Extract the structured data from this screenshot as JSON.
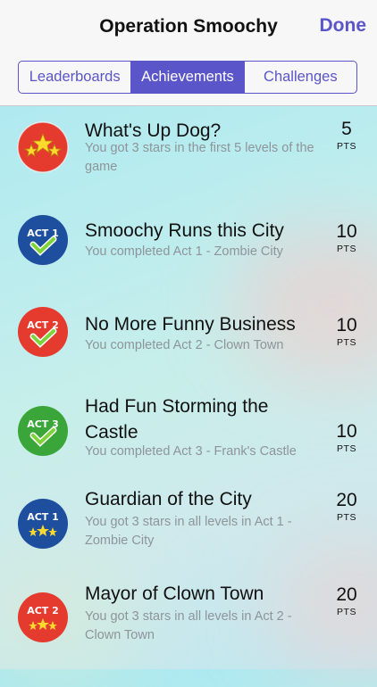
{
  "nav": {
    "title": "Operation Smoochy",
    "done_label": "Done"
  },
  "tabs": [
    {
      "label": "Leaderboards",
      "active": false
    },
    {
      "label": "Achievements",
      "active": true
    },
    {
      "label": "Challenges",
      "active": false
    }
  ],
  "pts_unit": "PTS",
  "achievements": [
    {
      "title": "What's Up Dog?",
      "description": "You got 3 stars in the first 5 levels of the game",
      "points": "5",
      "badge": {
        "icon": "three-stars-icon",
        "color": "#e53a2e"
      }
    },
    {
      "title": "Smoochy Runs this City",
      "description": "You completed Act 1 - Zombie City",
      "points": "10",
      "badge": {
        "icon": "act-1-check-icon",
        "label": "ACT 1",
        "color": "#1d4f9e"
      }
    },
    {
      "title": "No More Funny Business",
      "description": "You completed Act 2 - Clown Town",
      "points": "10",
      "badge": {
        "icon": "act-2-check-icon",
        "label": "ACT 2",
        "color": "#e53a2e"
      }
    },
    {
      "title": "Had Fun Storming the Castle",
      "description": "You completed Act 3 - Frank's Castle",
      "points": "10",
      "badge": {
        "icon": "act-3-check-icon",
        "label": "ACT 3",
        "color": "#3aa63a"
      }
    },
    {
      "title": "Guardian of the City",
      "description": "You got 3 stars in all levels in Act 1 - Zombie City",
      "points": "20",
      "badge": {
        "icon": "act-1-stars-icon",
        "label": "ACT 1",
        "color": "#1d4f9e"
      }
    },
    {
      "title": "Mayor of Clown Town",
      "description": "You got 3 stars in all levels in Act 2 - Clown Town",
      "points": "20",
      "badge": {
        "icon": "act-2-stars-icon",
        "label": "ACT 2",
        "color": "#e53a2e"
      }
    }
  ]
}
